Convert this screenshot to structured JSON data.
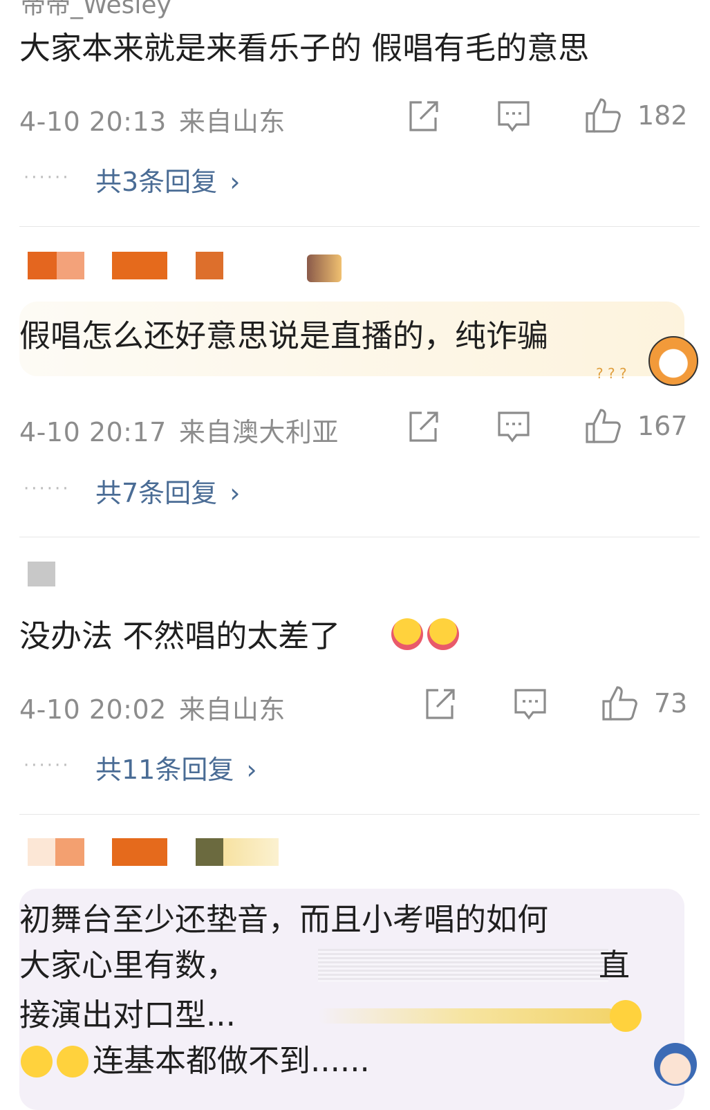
{
  "top_username": "帝帝_Wesley",
  "comments": [
    {
      "text_lines": [
        "大家本来就是来看乐子的 假唱有毛的意思"
      ],
      "time": "4-10 20:13",
      "location": "来自山东",
      "likes": "182",
      "replies_label": "共3条回复",
      "reply_dots": "······"
    },
    {
      "text_lines": [
        "假唱怎么还好意思说是直播的，纯诈骗"
      ],
      "time": "4-10 20:17",
      "location": "来自澳大利亚",
      "likes": "167",
      "replies_label": "共7条回复",
      "reply_dots": "······",
      "sticker_marks": "? ? ?"
    },
    {
      "text_lines": [
        "没办法 不然唱的太差了"
      ],
      "time": "4-10 20:02",
      "location": "来自山东",
      "likes": "73",
      "replies_label": "共11条回复",
      "reply_dots": "······"
    },
    {
      "text_lines": [
        "初舞台至少还垫音，而且小考唱的如何",
        "大家心里有数，",
        "接演出对口型...",
        "连基本都做不到......"
      ],
      "line_end_chars": [
        "直"
      ]
    }
  ],
  "chevron": "›",
  "icons": [
    "share-icon",
    "comment-icon",
    "like-icon"
  ],
  "colors": {
    "text": "#1f1f1f",
    "meta": "#8c8c8c",
    "link": "#4a6c95",
    "divider": "#e6e6e6",
    "orange": "#e56a1c"
  }
}
